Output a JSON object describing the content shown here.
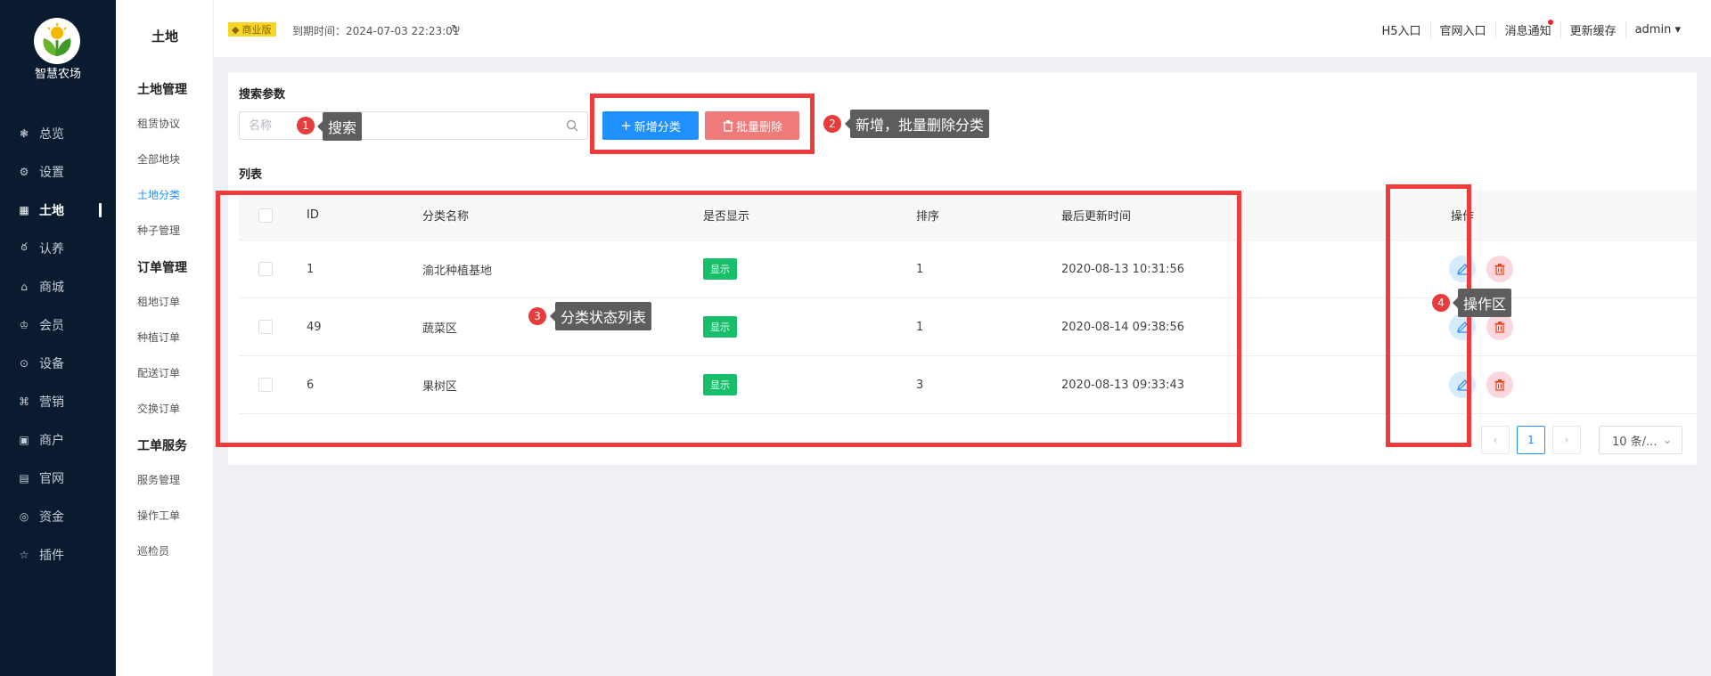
{
  "app": {
    "name": "智慧农场"
  },
  "nav": {
    "items": [
      {
        "label": "总览",
        "icon": "dashboard-icon"
      },
      {
        "label": "设置",
        "icon": "gear-icon"
      },
      {
        "label": "土地",
        "icon": "grid-icon",
        "active": true
      },
      {
        "label": "认养",
        "icon": "adopt-icon"
      },
      {
        "label": "商城",
        "icon": "shop-icon"
      },
      {
        "label": "会员",
        "icon": "crown-icon"
      },
      {
        "label": "设备",
        "icon": "location-icon"
      },
      {
        "label": "营销",
        "icon": "command-icon"
      },
      {
        "label": "商户",
        "icon": "store-icon"
      },
      {
        "label": "官网",
        "icon": "window-icon"
      },
      {
        "label": "资金",
        "icon": "coin-icon"
      },
      {
        "label": "插件",
        "icon": "star-icon"
      }
    ]
  },
  "submenu": {
    "title": "土地",
    "groups": [
      {
        "title": "土地管理",
        "items": [
          "租赁协议",
          "全部地块",
          "土地分类",
          "种子管理"
        ]
      },
      {
        "title": "订单管理",
        "items": [
          "租地订单",
          "种植订单",
          "配送订单",
          "交换订单"
        ]
      },
      {
        "title": "工单服务",
        "items": [
          "服务管理",
          "操作工单",
          "巡检员"
        ]
      }
    ],
    "active": "土地分类"
  },
  "header": {
    "badge": "商业版",
    "expire": "到期时间：2024-07-03 22:23:01",
    "links": [
      "H5入口",
      "官网入口",
      "消息通知",
      "更新缓存",
      "admin"
    ]
  },
  "search": {
    "section_label": "搜索参数",
    "placeholder": "名称",
    "add_button": "新增分类",
    "delete_button": "批量删除"
  },
  "list": {
    "section_label": "列表",
    "columns": [
      "ID",
      "分类名称",
      "是否显示",
      "排序",
      "最后更新时间",
      "操作"
    ],
    "rows": [
      {
        "id": "1",
        "name": "渝北种植基地",
        "show": "显示",
        "sort": "1",
        "updated": "2020-08-13 10:31:56"
      },
      {
        "id": "49",
        "name": "蔬菜区",
        "show": "显示",
        "sort": "1",
        "updated": "2020-08-14 09:38:56"
      },
      {
        "id": "6",
        "name": "果树区",
        "show": "显示",
        "sort": "3",
        "updated": "2020-08-13 09:33:43"
      }
    ]
  },
  "pager": {
    "current": "1",
    "page_size": "10 条/..."
  },
  "annotations": [
    {
      "num": "1",
      "text": "搜索"
    },
    {
      "num": "2",
      "text": "新增，批量删除分类"
    },
    {
      "num": "3",
      "text": "分类状态列表"
    },
    {
      "num": "4",
      "text": "操作区"
    }
  ],
  "colors": {
    "primary": "#1e90ff",
    "danger": "#f07a7a",
    "success": "#19be6b",
    "sidebar": "#0a1a2f",
    "annotation": "#ee3b3b"
  }
}
